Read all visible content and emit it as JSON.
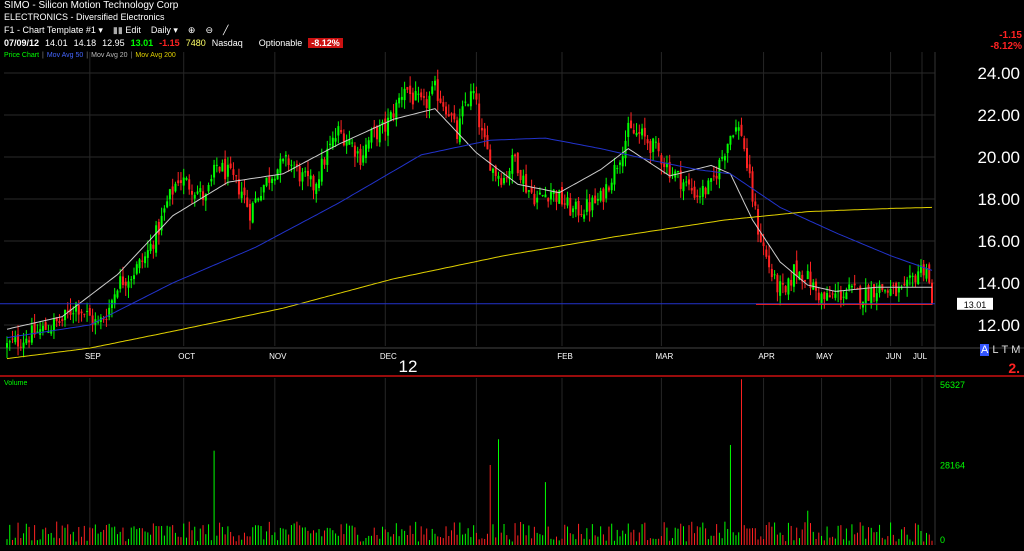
{
  "header": {
    "symbol_title": "SIMO - Silicon Motion Technology Corp",
    "sector": "ELECTRONICS - Diversified Electronics",
    "toolbar": {
      "template": "F1 - Chart Template #1",
      "edit": "Edit",
      "interval": "Daily"
    },
    "quote": {
      "date": "07/09/12",
      "open": "14.01",
      "high": "14.18",
      "low": "12.95",
      "last": "13.01",
      "change": "-1.15",
      "volume": "7480",
      "exchange": "Nasdaq",
      "optionable": "Optionable",
      "pct_change": "-8.12%"
    },
    "indicators": [
      "Price Chart",
      "Mov Avg 50",
      "Mov Avg 20",
      "Mov Avg 200"
    ],
    "right_change": "-1.15",
    "right_pct": "-8.12%"
  },
  "mode_buttons": [
    "A",
    "L",
    "T",
    "M"
  ],
  "right_value_fragment": "2.",
  "colors": {
    "up": "#00ff00",
    "down": "#ff2222",
    "ma20": "#cccccc",
    "ma50": "#2233cc",
    "ma200": "#e0d000",
    "last_line": "#2233cc",
    "grid": "#2a2a2a"
  },
  "chart_data": [
    {
      "type": "candlestick",
      "title": "",
      "y_ticks": [
        "24.00",
        "22.00",
        "20.00",
        "18.00",
        "16.00",
        "14.00",
        "12.00"
      ],
      "ylim": [
        11.0,
        25.0
      ],
      "x_labels": [
        "SEP",
        "OCT",
        "NOV",
        "DEC",
        "12",
        "FEB",
        "MAR",
        "APR",
        "MAY",
        "JUN",
        "JUL"
      ],
      "last_price_label": "13.01",
      "last_price": 13.01,
      "series": [
        {
          "name": "Mov Avg 20",
          "anchors": [
            [
              0,
              11.8
            ],
            [
              20,
              12.4
            ],
            [
              40,
              14.4
            ],
            [
              60,
              17.2
            ],
            [
              80,
              18.8
            ],
            [
              100,
              19.2
            ],
            [
              120,
              20.6
            ],
            [
              140,
              21.8
            ],
            [
              155,
              22.3
            ],
            [
              170,
              20.2
            ],
            [
              185,
              18.7
            ],
            [
              200,
              18.3
            ],
            [
              215,
              19.4
            ],
            [
              225,
              20.4
            ],
            [
              240,
              19.1
            ],
            [
              255,
              19.6
            ],
            [
              262,
              19.2
            ],
            [
              270,
              17.0
            ],
            [
              280,
              15.0
            ],
            [
              290,
              13.9
            ],
            [
              300,
              13.6
            ],
            [
              315,
              13.8
            ],
            [
              335,
              13.8
            ]
          ]
        },
        {
          "name": "Mov Avg 50",
          "anchors": [
            [
              0,
              11.4
            ],
            [
              30,
              12.0
            ],
            [
              60,
              14.0
            ],
            [
              90,
              15.7
            ],
            [
              120,
              17.8
            ],
            [
              150,
              20.1
            ],
            [
              175,
              20.8
            ],
            [
              195,
              20.9
            ],
            [
              215,
              20.4
            ],
            [
              235,
              19.8
            ],
            [
              250,
              19.4
            ],
            [
              262,
              19.2
            ],
            [
              280,
              17.6
            ],
            [
              300,
              16.4
            ],
            [
              320,
              15.3
            ],
            [
              335,
              14.6
            ]
          ]
        },
        {
          "name": "Mov Avg 200",
          "anchors": [
            [
              0,
              10.4
            ],
            [
              30,
              10.9
            ],
            [
              60,
              11.7
            ],
            [
              100,
              12.8
            ],
            [
              140,
              14.2
            ],
            [
              180,
              15.3
            ],
            [
              220,
              16.2
            ],
            [
              260,
              17.0
            ],
            [
              290,
              17.4
            ],
            [
              320,
              17.55
            ],
            [
              335,
              17.6
            ]
          ]
        }
      ],
      "candles": "seeded random-walk approximation of daily OHLC following 10.8 (Sep) to 23.5 (Jan) to 13.01 (Jul)"
    },
    {
      "type": "bar",
      "title": "Volume",
      "y_ticks": [
        "56327",
        "28164",
        "0"
      ],
      "ylim": [
        0,
        56327
      ],
      "spikes": [
        [
          75,
          33000
        ],
        [
          116,
          6000
        ],
        [
          175,
          28000
        ],
        [
          178,
          37000
        ],
        [
          195,
          22000
        ],
        [
          262,
          35000
        ],
        [
          266,
          58000
        ],
        [
          290,
          12000
        ],
        [
          313,
          6000
        ]
      ]
    }
  ]
}
